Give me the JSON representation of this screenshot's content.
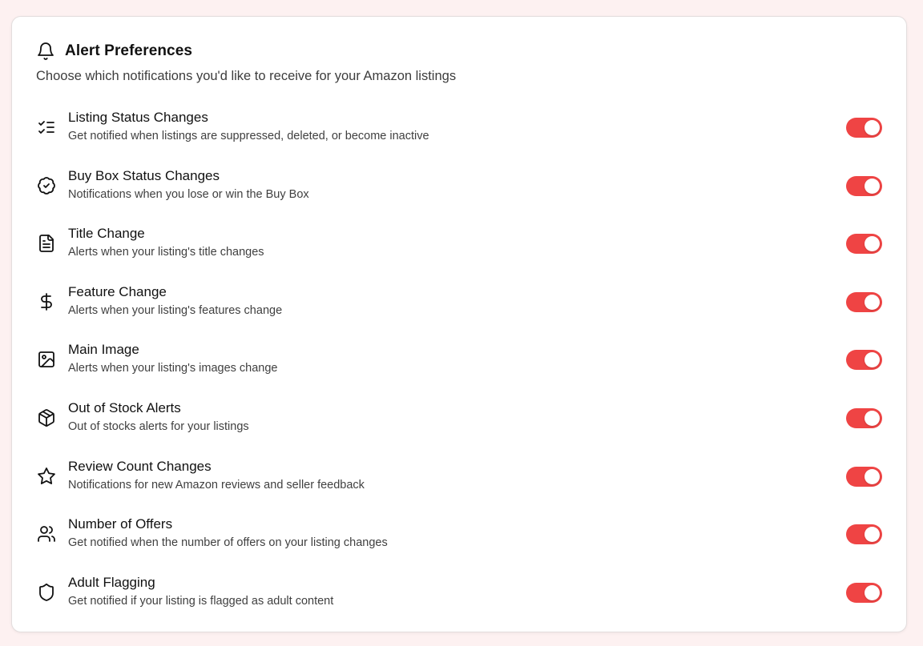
{
  "header": {
    "title": "Alert Preferences",
    "subtitle": "Choose which notifications you'd like to receive for your Amazon listings",
    "icon": "bell-icon"
  },
  "alerts": [
    {
      "label": "Listing Status Changes",
      "description": "Get notified when listings are suppressed, deleted, or become inactive",
      "icon": "list-checks-icon",
      "enabled": true
    },
    {
      "label": "Buy Box Status Changes",
      "description": "Notifications when you lose or win the Buy Box",
      "icon": "badge-check-icon",
      "enabled": true
    },
    {
      "label": "Title Change",
      "description": "Alerts when your listing's title changes",
      "icon": "file-text-icon",
      "enabled": true
    },
    {
      "label": "Feature Change",
      "description": "Alerts when your listing's features change",
      "icon": "dollar-sign-icon",
      "enabled": true
    },
    {
      "label": "Main Image",
      "description": "Alerts when your listing's images change",
      "icon": "image-icon",
      "enabled": true
    },
    {
      "label": "Out of Stock Alerts",
      "description": "Out of stocks alerts for your listings",
      "icon": "package-icon",
      "enabled": true
    },
    {
      "label": "Review Count Changes",
      "description": "Notifications for new Amazon reviews and seller feedback",
      "icon": "star-icon",
      "enabled": true
    },
    {
      "label": "Number of Offers",
      "description": "Get notified when the number of offers on your listing changes",
      "icon": "users-icon",
      "enabled": true
    },
    {
      "label": "Adult Flagging",
      "description": "Get notified if your listing is flagged as adult content",
      "icon": "shield-icon",
      "enabled": true
    }
  ],
  "colors": {
    "toggle_on": "#ef4444",
    "page_background": "#fdf1f1",
    "card_background": "#ffffff"
  }
}
